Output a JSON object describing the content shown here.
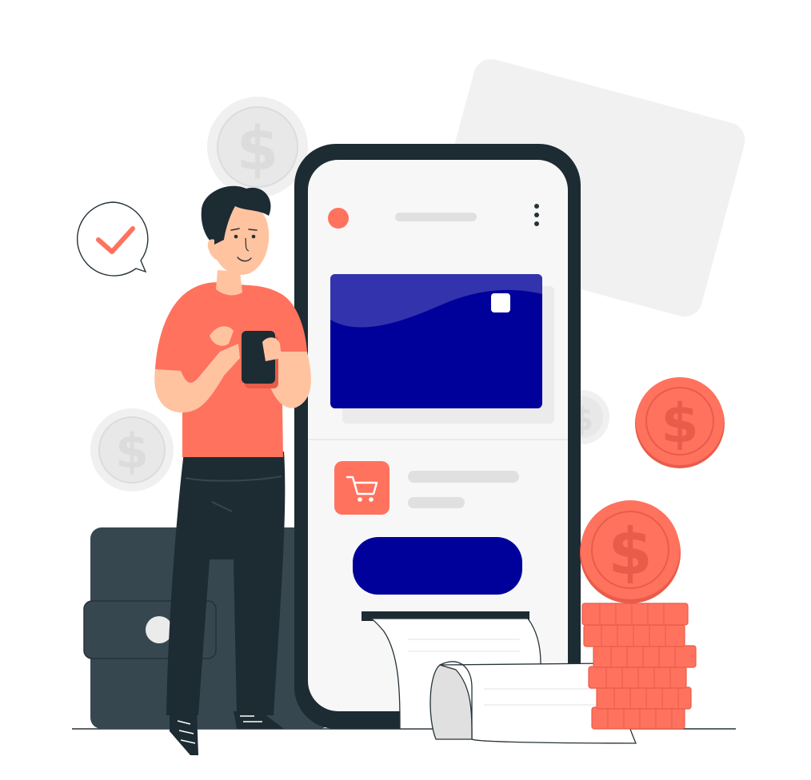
{
  "illustration": {
    "subject": "mobile payment",
    "currency_symbol": "$",
    "colors": {
      "accent": "#ff725e",
      "accent_dark": "#e85c49",
      "navy": "#00009b",
      "navy_light": "#3333ad",
      "phone_frame": "#1d2b33",
      "phone_screen": "#f7f7f7",
      "wallet": "#37474f",
      "skin": "#ffc3a0",
      "hair": "#1d2b33",
      "pants": "#1d2b33",
      "gray_coin": "#efefef",
      "gray_card": "#f1f1f1"
    },
    "icons": {
      "app_header_dot": "status-dot",
      "menu": "kebab-menu-icon",
      "cart": "shopping-cart-icon",
      "check": "check-icon"
    }
  }
}
